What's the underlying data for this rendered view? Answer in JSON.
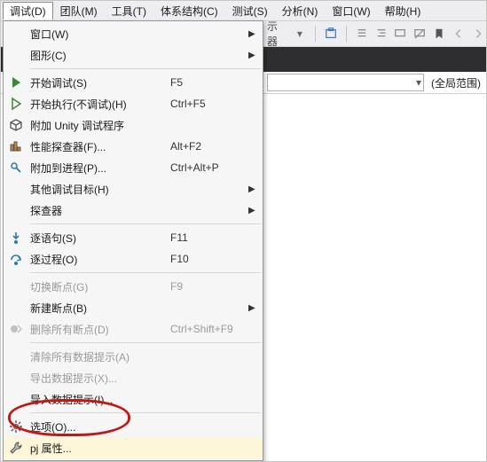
{
  "menubar": {
    "items": [
      {
        "label": "调试(D)"
      },
      {
        "label": "团队(M)"
      },
      {
        "label": "工具(T)"
      },
      {
        "label": "体系结构(C)"
      },
      {
        "label": "测试(S)"
      },
      {
        "label": "分析(N)"
      },
      {
        "label": "窗口(W)"
      },
      {
        "label": "帮助(H)"
      }
    ],
    "active_index": 0
  },
  "toolbar": {
    "label": "示器"
  },
  "scope_label": "(全局范围)",
  "menu": {
    "groups": [
      [
        {
          "label": "窗口(W)",
          "shortcut": "",
          "submenu": true,
          "enabled": true,
          "icon": ""
        },
        {
          "label": "图形(C)",
          "shortcut": "",
          "submenu": true,
          "enabled": true,
          "icon": ""
        }
      ],
      [
        {
          "label": "开始调试(S)",
          "shortcut": "F5",
          "submenu": false,
          "enabled": true,
          "icon": "play-green"
        },
        {
          "label": "开始执行(不调试)(H)",
          "shortcut": "Ctrl+F5",
          "submenu": false,
          "enabled": true,
          "icon": "play-outline"
        },
        {
          "label": "附加 Unity 调试程序",
          "shortcut": "",
          "submenu": false,
          "enabled": true,
          "icon": "cube"
        },
        {
          "label": "性能探查器(F)...",
          "shortcut": "Alt+F2",
          "submenu": false,
          "enabled": true,
          "icon": "profiler"
        },
        {
          "label": "附加到进程(P)...",
          "shortcut": "Ctrl+Alt+P",
          "submenu": false,
          "enabled": true,
          "icon": "attach"
        },
        {
          "label": "其他调试目标(H)",
          "shortcut": "",
          "submenu": true,
          "enabled": true,
          "icon": ""
        },
        {
          "label": "探查器",
          "shortcut": "",
          "submenu": true,
          "enabled": true,
          "icon": ""
        }
      ],
      [
        {
          "label": "逐语句(S)",
          "shortcut": "F11",
          "submenu": false,
          "enabled": true,
          "icon": "step-into"
        },
        {
          "label": "逐过程(O)",
          "shortcut": "F10",
          "submenu": false,
          "enabled": true,
          "icon": "step-over"
        }
      ],
      [
        {
          "label": "切换断点(G)",
          "shortcut": "F9",
          "submenu": false,
          "enabled": false,
          "icon": ""
        },
        {
          "label": "新建断点(B)",
          "shortcut": "",
          "submenu": true,
          "enabled": true,
          "icon": ""
        },
        {
          "label": "删除所有断点(D)",
          "shortcut": "Ctrl+Shift+F9",
          "submenu": false,
          "enabled": false,
          "icon": "delete-bp"
        }
      ],
      [
        {
          "label": "清除所有数据提示(A)",
          "shortcut": "",
          "submenu": false,
          "enabled": false,
          "icon": ""
        },
        {
          "label": "导出数据提示(X)...",
          "shortcut": "",
          "submenu": false,
          "enabled": false,
          "icon": ""
        },
        {
          "label": "导入数据提示(I)...",
          "shortcut": "",
          "submenu": false,
          "enabled": true,
          "icon": ""
        }
      ],
      [
        {
          "label": "选项(O)...",
          "shortcut": "",
          "submenu": false,
          "enabled": true,
          "icon": "gear"
        },
        {
          "label": "pj 属性...",
          "shortcut": "",
          "submenu": false,
          "enabled": true,
          "icon": "wrench",
          "highlighted": true
        }
      ]
    ]
  }
}
